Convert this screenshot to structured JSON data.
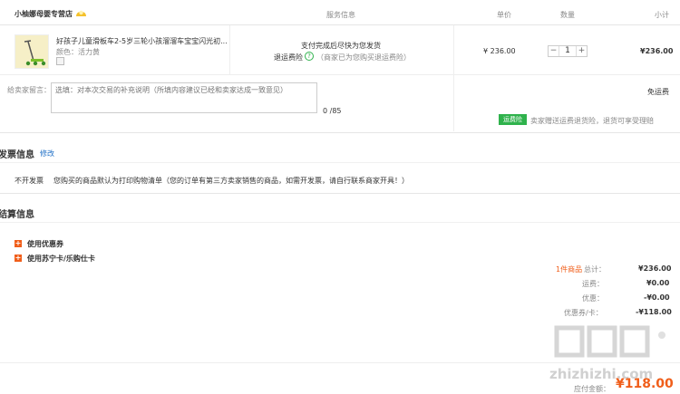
{
  "shop": {
    "name": "小柚娜母婴专营店"
  },
  "header": {
    "service": "服务信息",
    "unit_price": "单价",
    "quantity": "数量",
    "subtotal": "小计"
  },
  "item": {
    "title": "好孩子儿童滑板车2-5岁三轮小孩溜溜车宝宝闪光初...",
    "color": "颜色：活力黄",
    "service_line1": "支付完成后尽快为您发货",
    "service_label": "退运费险",
    "service_note": "（商家已为您购买退运费险）",
    "unit_price": "¥ 236.00",
    "quantity": "1",
    "minus": "−",
    "plus": "+",
    "subtotal": "¥236.00"
  },
  "remark": {
    "label": "给卖家留言：",
    "placeholder": "选填：对本次交易的补充说明（所填内容建议已经和卖家达成一致意见）",
    "counter": "0 /85"
  },
  "shipping": {
    "free": "免运费",
    "badge": "运费险",
    "desc": "卖家赠送运费退货险，退货可享受理赔"
  },
  "invoice": {
    "title": "发票信息",
    "edit": "修改",
    "type": "不开发票",
    "desc": "您购买的商品默认为打印购物清单（您的订单有第三方卖家销售的商品，如需开发票，请自行联系商家开具！）"
  },
  "settle": {
    "title": "结算信息",
    "coupon": "使用优惠券",
    "card": "使用苏宁卡/乐购仕卡"
  },
  "summary": {
    "count_prefix": "1件商品",
    "total_label": "总计：",
    "total": "¥236.00",
    "freight_label": "运费：",
    "freight": "¥0.00",
    "discount_label": "优惠：",
    "discount": "-¥0.00",
    "voucher_label": "优惠券/卡：",
    "voucher": "-¥118.00",
    "payable_label": "应付金额：",
    "payable": "¥118.00"
  },
  "colors": {
    "accent": "#f05e1a",
    "green": "#2fb24c",
    "link": "#1e6fc6"
  }
}
